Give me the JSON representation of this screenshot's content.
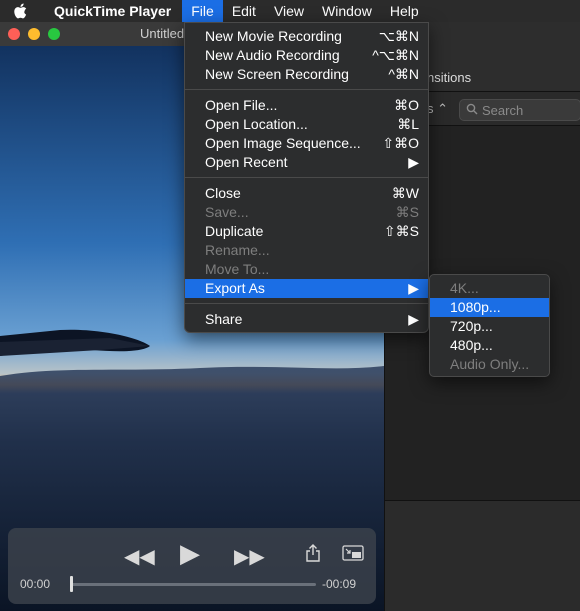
{
  "menubar": {
    "app_name": "QuickTime Player",
    "items": [
      "File",
      "Edit",
      "View",
      "Window",
      "Help"
    ]
  },
  "player": {
    "title": "Untitled",
    "time_elapsed": "00:00",
    "time_remaining": "-00:09",
    "progress": 0
  },
  "right_window": {
    "tab_text": "nsitions",
    "selector_text": "s",
    "search_placeholder": "Search"
  },
  "file_menu": {
    "items": [
      {
        "label": "New Movie Recording",
        "shortcut": "⌥⌘N"
      },
      {
        "label": "New Audio Recording",
        "shortcut": "^⌥⌘N"
      },
      {
        "label": "New Screen Recording",
        "shortcut": "^⌘N"
      },
      {
        "label": "Open File...",
        "shortcut": "⌘O"
      },
      {
        "label": "Open Location...",
        "shortcut": "⌘L"
      },
      {
        "label": "Open Image Sequence...",
        "shortcut": "⇧⌘O"
      },
      {
        "label": "Open Recent",
        "shortcut": "▶"
      },
      {
        "label": "Close",
        "shortcut": "⌘W"
      },
      {
        "label": "Save...",
        "shortcut": "⌘S"
      },
      {
        "label": "Duplicate",
        "shortcut": "⇧⌘S"
      },
      {
        "label": "Rename..."
      },
      {
        "label": "Move To..."
      },
      {
        "label": "Export As",
        "shortcut": "▶"
      },
      {
        "label": "Share",
        "shortcut": "▶"
      }
    ]
  },
  "export_submenu": {
    "items": [
      {
        "label": "4K..."
      },
      {
        "label": "1080p..."
      },
      {
        "label": "720p..."
      },
      {
        "label": "480p..."
      },
      {
        "label": "Audio Only..."
      }
    ]
  },
  "colors": {
    "menu_highlight": "#1b6ee5",
    "menu_bg": "#2c2d2e"
  },
  "icons": [
    "apple-icon",
    "rewind-icon",
    "play-icon",
    "fast-forward-icon",
    "share-icon",
    "pip-icon",
    "search-icon",
    "chevron-right-icon"
  ]
}
